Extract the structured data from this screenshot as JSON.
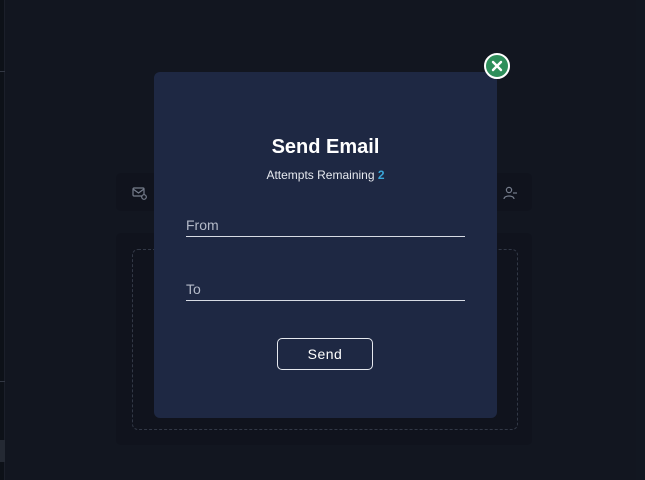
{
  "modal": {
    "title": "Send Email",
    "attempts_label": "Attempts Remaining",
    "attempts_count": "2",
    "from_placeholder": "From",
    "from_value": "",
    "to_placeholder": "To",
    "to_value": "",
    "send_label": "Send",
    "close_icon": "close-icon"
  },
  "background": {
    "toolbar_left_icon": "mail-settings-icon",
    "toolbar_right_icon": "user-remove-icon"
  },
  "colors": {
    "page_bg": "#141924",
    "modal_bg": "#1e2843",
    "close_green": "#2e8f5b",
    "accent_blue": "#3aa6d8"
  }
}
